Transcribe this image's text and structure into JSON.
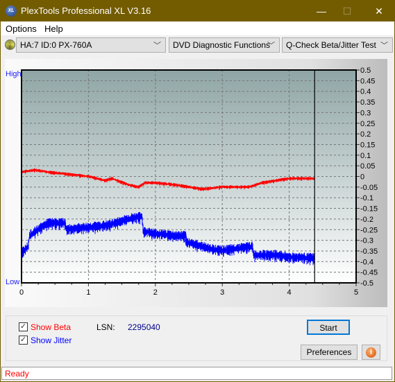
{
  "window": {
    "title": "PlexTools Professional XL V3.16",
    "logo_text": "XL",
    "minimize": "—",
    "maximize": "☐",
    "close": "✕"
  },
  "menu": [
    {
      "label": "Options"
    },
    {
      "label": "Help"
    }
  ],
  "toolbar": {
    "drive": "HA:7 ID:0  PX-760A",
    "function": "DVD Diagnostic Functions",
    "test": "Q-Check Beta/Jitter Test"
  },
  "chart_data": {
    "type": "line",
    "left_labels": {
      "high": "High",
      "low": "Low"
    },
    "xlim": [
      0,
      5
    ],
    "ylim": [
      -0.5,
      0.5
    ],
    "x_ticks": [
      "0",
      "1",
      "2",
      "3",
      "4",
      "5"
    ],
    "y_ticks": [
      "0.5",
      "0.45",
      "0.4",
      "0.35",
      "0.3",
      "0.25",
      "0.2",
      "0.15",
      "0.1",
      "0.05",
      "0",
      "-0.05",
      "-0.1",
      "-0.15",
      "-0.2",
      "-0.25",
      "-0.3",
      "-0.35",
      "-0.4",
      "-0.45",
      "-0.5"
    ],
    "grid": true,
    "cursor_x": 4.38,
    "series": [
      {
        "key": "beta",
        "color": "#ff0000",
        "points": [
          [
            0,
            0.02
          ],
          [
            0.2,
            0.03
          ],
          [
            0.4,
            0.02
          ],
          [
            0.7,
            0.01
          ],
          [
            1.0,
            0.0
          ],
          [
            1.25,
            -0.02
          ],
          [
            1.35,
            -0.01
          ],
          [
            1.6,
            -0.04
          ],
          [
            1.75,
            -0.05
          ],
          [
            1.85,
            -0.03
          ],
          [
            2.0,
            -0.03
          ],
          [
            2.3,
            -0.04
          ],
          [
            2.5,
            -0.05
          ],
          [
            2.7,
            -0.06
          ],
          [
            3.0,
            -0.05
          ],
          [
            3.4,
            -0.05
          ],
          [
            3.6,
            -0.03
          ],
          [
            3.8,
            -0.02
          ],
          [
            4.0,
            -0.01
          ],
          [
            4.38,
            -0.01
          ]
        ]
      },
      {
        "key": "jitter",
        "color": "#0000ff",
        "points": [
          [
            0,
            -0.36
          ],
          [
            0.1,
            -0.33
          ],
          [
            0.12,
            -0.28
          ],
          [
            0.3,
            -0.24
          ],
          [
            0.4,
            -0.22
          ],
          [
            0.65,
            -0.22
          ],
          [
            0.67,
            -0.25
          ],
          [
            1.0,
            -0.24
          ],
          [
            1.3,
            -0.23
          ],
          [
            1.4,
            -0.22
          ],
          [
            1.6,
            -0.2
          ],
          [
            1.8,
            -0.19
          ],
          [
            1.82,
            -0.26
          ],
          [
            2.0,
            -0.27
          ],
          [
            2.3,
            -0.28
          ],
          [
            2.45,
            -0.28
          ],
          [
            2.47,
            -0.31
          ],
          [
            2.7,
            -0.33
          ],
          [
            2.8,
            -0.34
          ],
          [
            3.0,
            -0.35
          ],
          [
            3.2,
            -0.34
          ],
          [
            3.45,
            -0.33
          ],
          [
            3.47,
            -0.37
          ],
          [
            3.8,
            -0.37
          ],
          [
            4.0,
            -0.38
          ],
          [
            4.38,
            -0.385
          ]
        ]
      }
    ]
  },
  "controls": {
    "show_beta": "Show Beta",
    "show_jitter": "Show Jitter",
    "show_beta_checked": true,
    "show_jitter_checked": true,
    "lsn_label": "LSN:",
    "lsn_value": "2295040",
    "start": "Start",
    "preferences": "Preferences",
    "info_icon": "info-icon"
  },
  "colors": {
    "beta": "#ff0000",
    "jitter": "#0000ff",
    "titlebar": "#735c00"
  },
  "status": "Ready"
}
